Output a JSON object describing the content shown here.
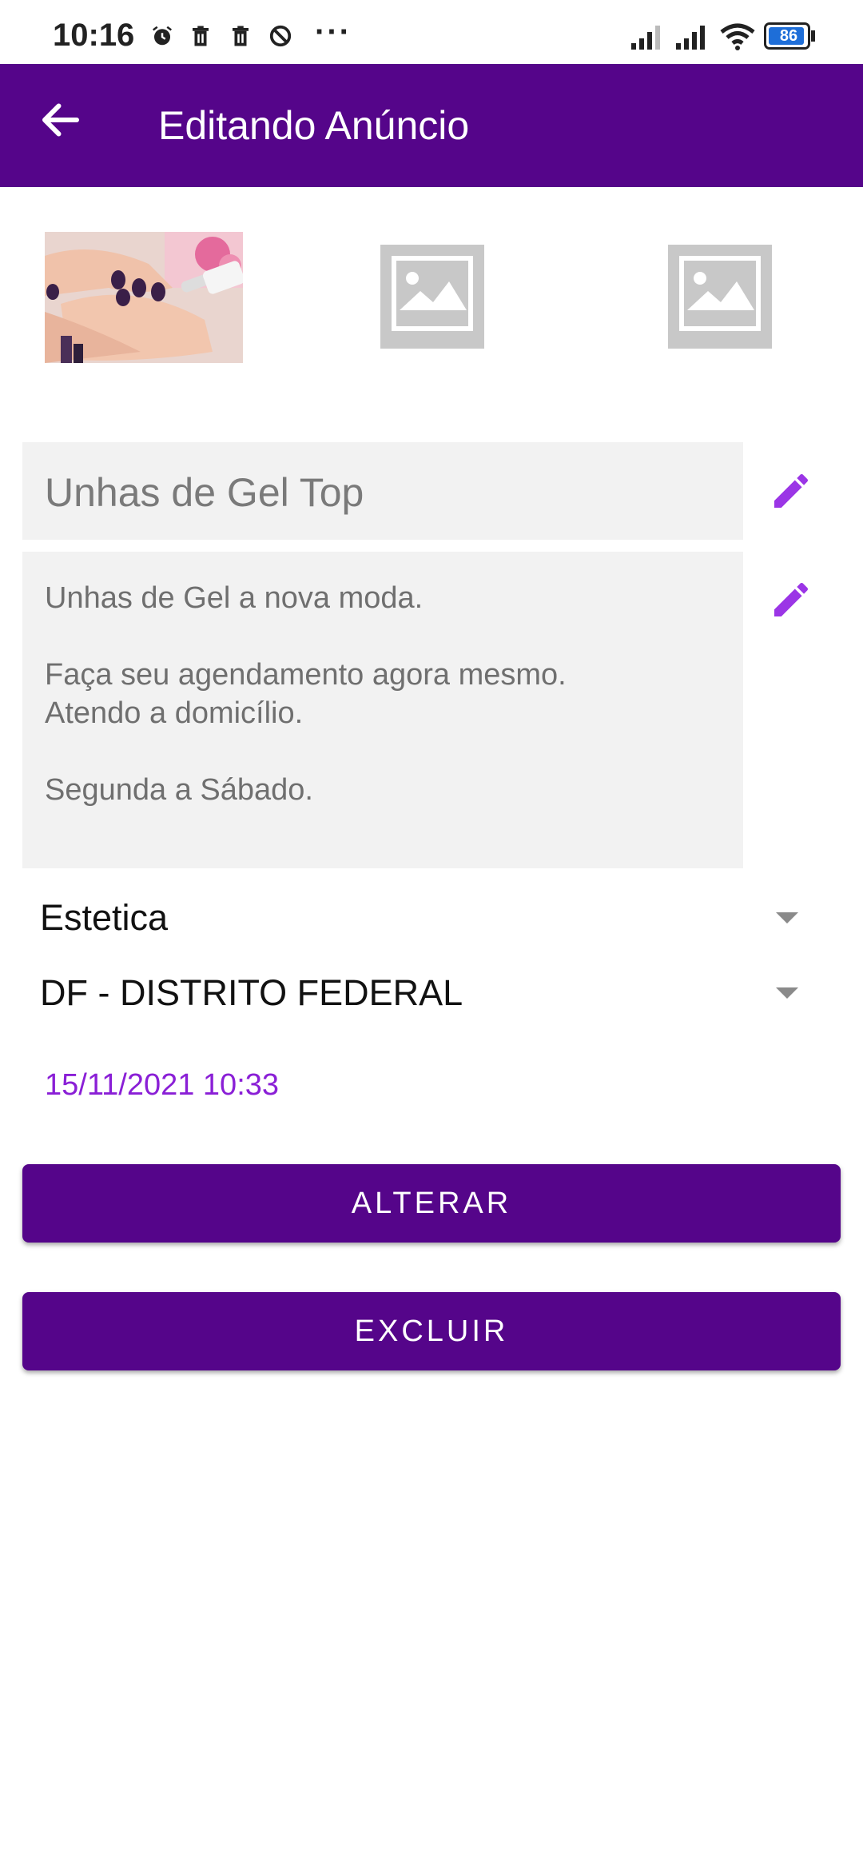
{
  "status_bar": {
    "time": "10:16",
    "more": "···",
    "battery": "86"
  },
  "app_bar": {
    "title": "Editando Anúncio",
    "back_icon": "arrow-left-icon"
  },
  "images": [
    {
      "type": "photo",
      "description_icon": "nail-photo"
    },
    {
      "type": "placeholder",
      "icon": "image-placeholder-icon"
    },
    {
      "type": "placeholder",
      "icon": "image-placeholder-icon"
    }
  ],
  "form": {
    "title_value": "Unhas de Gel Top",
    "description_value": "Unhas de Gel a nova moda.\n\nFaça seu agendamento agora mesmo.\nAtendo a domicílio.\n\nSegunda a Sábado.",
    "category_value": "Estetica",
    "state_value": "DF - DISTRITO FEDERAL",
    "date_value": "15/11/2021 10:33"
  },
  "buttons": {
    "alter_label": "ALTERAR",
    "delete_label": "EXCLUIR"
  },
  "colors": {
    "primary": "#55058a",
    "accent": "#9b35e6",
    "date_text": "#8a1fd6",
    "field_bg": "#f2f2f2"
  }
}
